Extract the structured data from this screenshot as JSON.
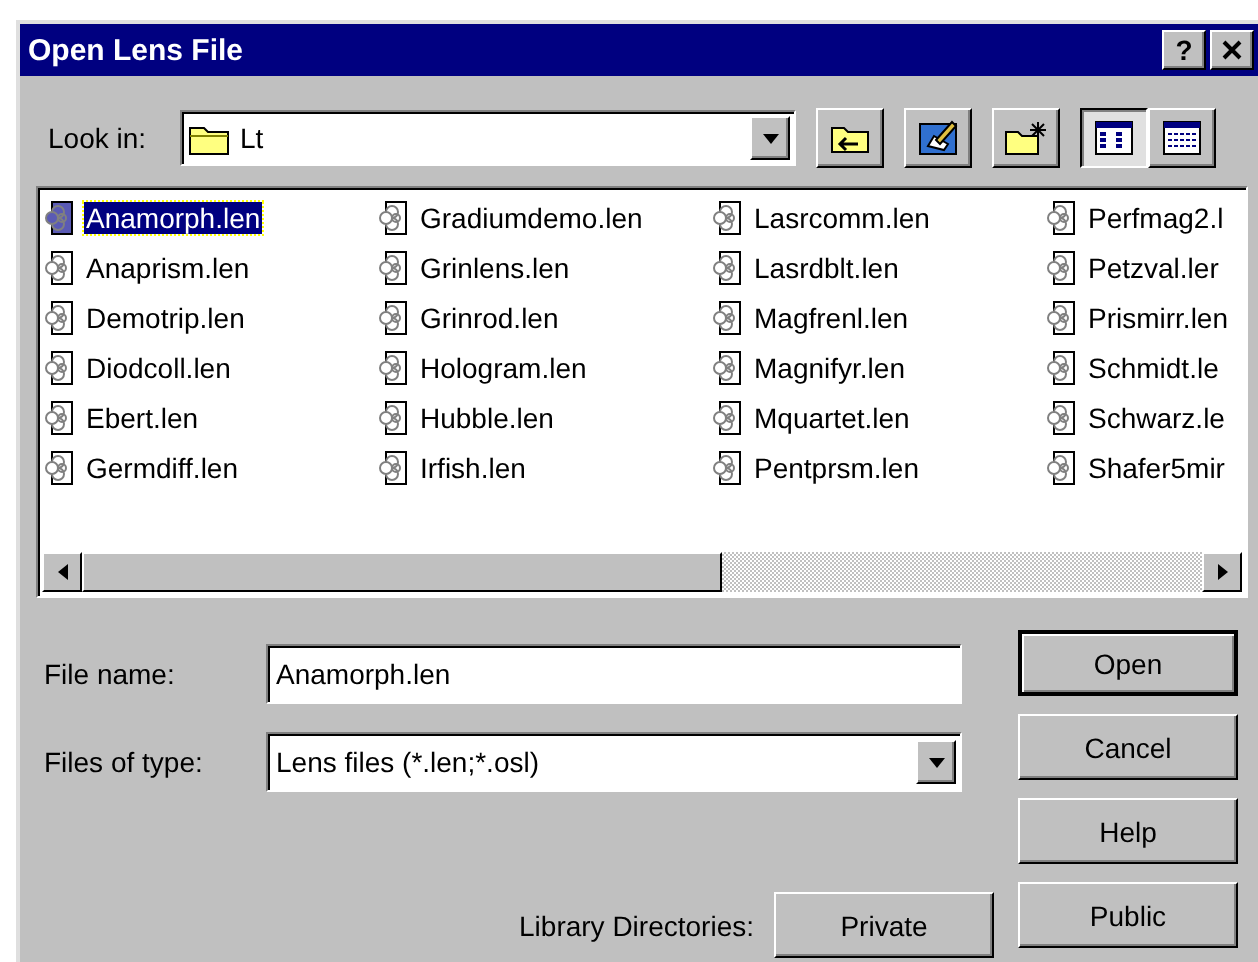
{
  "window": {
    "title": "Open Lens File",
    "title_buttons": [
      "?"
    ]
  },
  "look_in": {
    "label": "Look in:",
    "value": "Lt"
  },
  "toolbar": [
    {
      "kind": "up",
      "selected": false
    },
    {
      "kind": "edit",
      "selected": false
    },
    {
      "kind": "new-folder",
      "selected": false
    },
    {
      "kind": "list",
      "selected": true
    },
    {
      "kind": "details",
      "selected": false
    }
  ],
  "files": [
    {
      "name": "Anamorph.len",
      "selected": true
    },
    {
      "name": "Anaprism.len",
      "selected": false
    },
    {
      "name": "Demotrip.len",
      "selected": false
    },
    {
      "name": "Diodcoll.len",
      "selected": false
    },
    {
      "name": "Ebert.len",
      "selected": false
    },
    {
      "name": "Germdiff.len",
      "selected": false
    },
    {
      "name": "Gradiumdemo.len",
      "selected": false
    },
    {
      "name": "Grinlens.len",
      "selected": false
    },
    {
      "name": "Grinrod.len",
      "selected": false
    },
    {
      "name": "Hologram.len",
      "selected": false
    },
    {
      "name": "Hubble.len",
      "selected": false
    },
    {
      "name": "Irfish.len",
      "selected": false
    },
    {
      "name": "Lasrcomm.len",
      "selected": false
    },
    {
      "name": "Lasrdblt.len",
      "selected": false
    },
    {
      "name": "Magfrenl.len",
      "selected": false
    },
    {
      "name": "Magnifyr.len",
      "selected": false
    },
    {
      "name": "Mquartet.len",
      "selected": false
    },
    {
      "name": "Pentprsm.len",
      "selected": false
    },
    {
      "name": "Perfmag2.l",
      "selected": false
    },
    {
      "name": "Petzval.ler",
      "selected": false
    },
    {
      "name": "Prismirr.len",
      "selected": false
    },
    {
      "name": "Schmidt.le",
      "selected": false
    },
    {
      "name": "Schwarz.le",
      "selected": false
    },
    {
      "name": "Shafer5mir",
      "selected": false
    }
  ],
  "file_name": {
    "label": "File name:",
    "value": "Anamorph.len"
  },
  "file_type": {
    "label": "Files of type:",
    "value": "Lens files (*.len;*.osl)"
  },
  "buttons": [
    {
      "label": "Open",
      "default": true
    },
    {
      "label": "Cancel",
      "default": false
    },
    {
      "label": "Help",
      "default": false
    }
  ],
  "library": {
    "label": "Library Directories:",
    "buttons": [
      {
        "label": "Private"
      },
      {
        "label": "Public"
      }
    ]
  }
}
